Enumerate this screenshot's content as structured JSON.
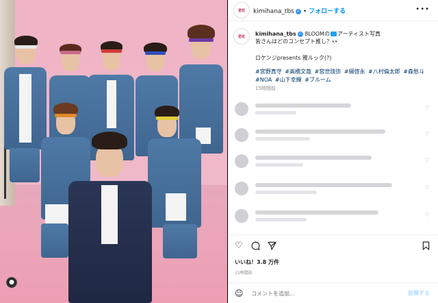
{
  "account": {
    "username": "kimihana_tbs",
    "follow_label": "フォローする",
    "avatar_text": "君花"
  },
  "caption": {
    "line1_pre": "8LOOMの",
    "line1_post": "アーティスト写真",
    "line2": "皆さんはどのコンセプト推し？👀",
    "line3": "ロケンジpresents 雅ルック(?)",
    "hashtags": [
      "#宮野真守",
      "#高橋文哉",
      "#宮世琉弥",
      "#綱啓永",
      "#八村倫太郎",
      "#森愁斗",
      "#NOA",
      "#山下幸輝",
      "#ブルーム"
    ],
    "time": "15時間前"
  },
  "actions": {
    "like_icon": "heart-icon",
    "comment_icon": "comment-icon",
    "share_icon": "share-icon",
    "save_icon": "bookmark-icon"
  },
  "likes": "いいね！3.8 万件",
  "post_time": "15時間前",
  "comment_box": {
    "placeholder": "コメントを追加...",
    "post_label": "投稿する"
  }
}
